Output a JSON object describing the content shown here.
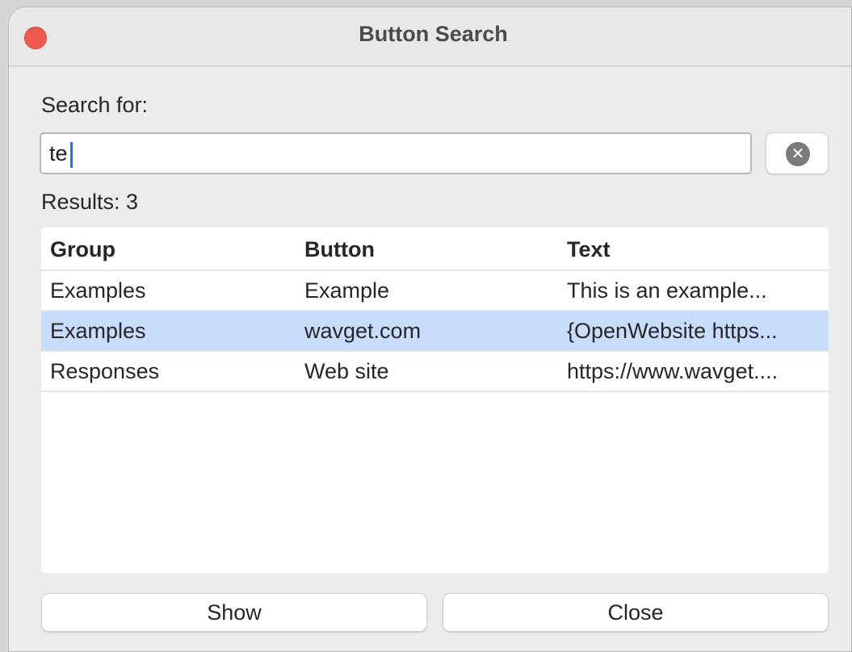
{
  "window": {
    "title": "Button Search"
  },
  "search": {
    "label": "Search for:",
    "value": "te",
    "clear_icon_glyph": "✕"
  },
  "results": {
    "label": "Results: 3"
  },
  "table": {
    "columns": [
      "Group",
      "Button",
      "Text"
    ],
    "rows": [
      {
        "group": "Examples",
        "button": "Example",
        "text": "This is an example...",
        "selected": false
      },
      {
        "group": "Examples",
        "button": "wavget.com",
        "text": "{OpenWebsite https...",
        "selected": true
      },
      {
        "group": "Responses",
        "button": "Web site",
        "text": "https://www.wavget...."
      }
    ]
  },
  "actions": {
    "show_label": "Show",
    "close_label": "Close"
  },
  "colors": {
    "selection": "#c8dcfb",
    "close_dot": "#ef5a52",
    "caret": "#1e6bff"
  }
}
